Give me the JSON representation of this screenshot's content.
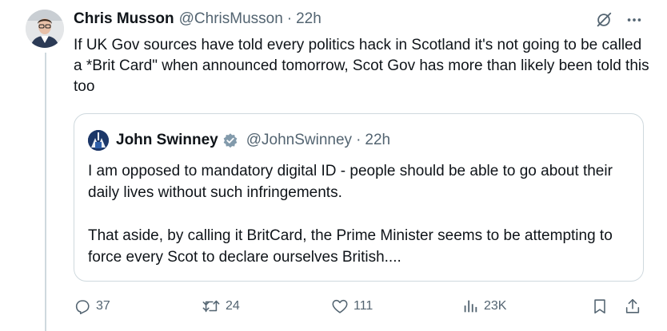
{
  "tweet": {
    "author_name": "Chris Musson",
    "author_handle": "@ChrisMusson",
    "separator": "·",
    "time": "22h",
    "text": "If UK Gov sources have told every politics hack in Scotland it's not going to be called a *Brit Card\" when announced tomorrow, Scot Gov has more than likely been told this too"
  },
  "quote": {
    "author_name": "John Swinney",
    "author_handle": "@JohnSwinney",
    "separator": "·",
    "time": "22h",
    "paragraphs": [
      "I am opposed to mandatory digital ID - people should be able to go about their daily lives without such infringements.",
      "That aside, by calling it BritCard, the Prime Minister seems to be attempting to force every Scot to declare ourselves British...."
    ]
  },
  "actions": {
    "replies": "37",
    "reposts": "24",
    "likes": "111",
    "views": "23K"
  },
  "icons": {
    "top": [
      "grok-icon",
      "more-icon"
    ],
    "actions": [
      "reply-icon",
      "repost-icon",
      "like-icon",
      "views-icon",
      "bookmark-icon",
      "share-icon"
    ]
  },
  "colors": {
    "text": "#0f1419",
    "secondary": "#536471",
    "border": "#cfd9de",
    "verified": "#829aab"
  }
}
